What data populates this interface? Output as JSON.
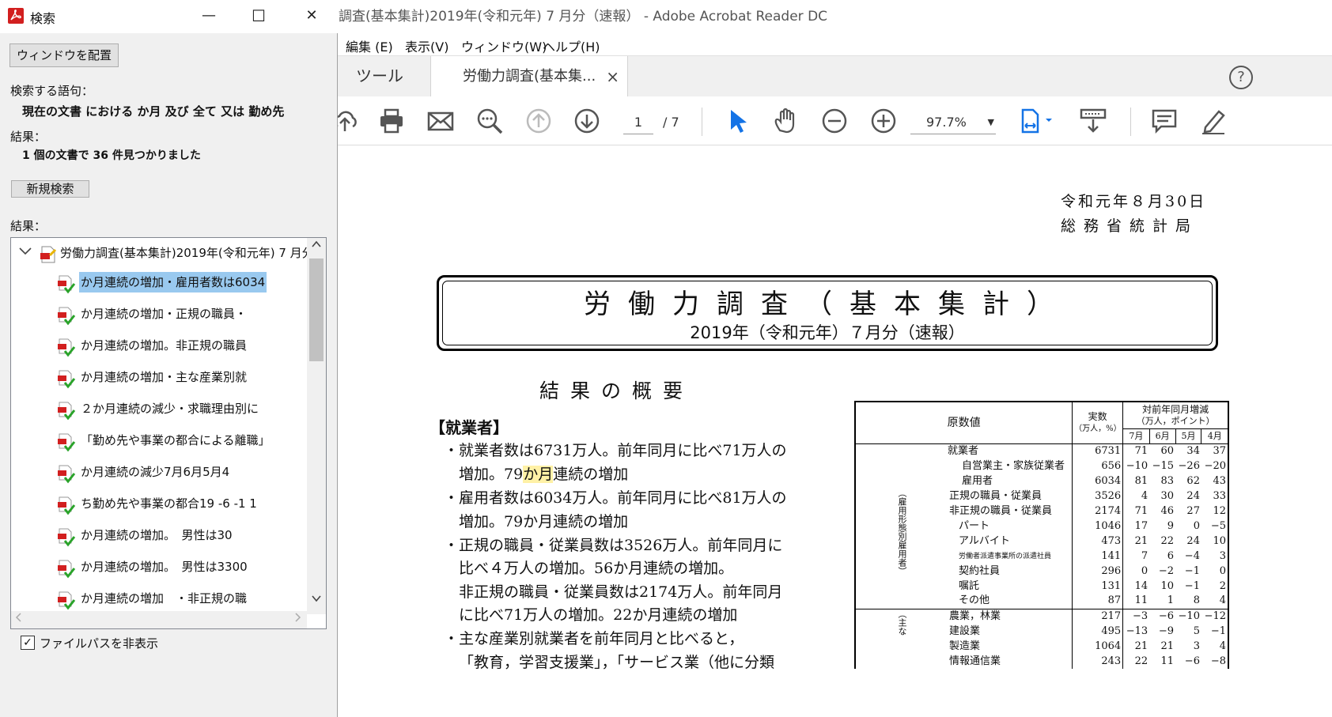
{
  "search_window": {
    "title": "検索",
    "minimize": "—",
    "maximize": "☐",
    "close": "✕",
    "arrange_button": "ウィンドウを配置",
    "term_label": "検索する語句：",
    "term_value": "現在の文書 における か月 及び 全て 又は 勤め先",
    "result_label": "結果：",
    "result_value": "1 個の文書で 36 件見つかりました",
    "new_search_button": "新規検索",
    "results_label": "結果：",
    "tree_root": "労働力調査(基本集計)2019年(令和元年) 7 月分",
    "results": [
      {
        "text": "か月連続の増加・雇用者数は6034",
        "selected": true
      },
      {
        "text": "か月連続の増加・正規の職員・",
        "selected": false
      },
      {
        "text": "か月連続の増加。非正規の職員",
        "selected": false
      },
      {
        "text": "か月連続の増加・主な産業別就",
        "selected": false
      },
      {
        "text": "２か月連続の減少・求職理由別に",
        "selected": false
      },
      {
        "text": "「勤め先や事業の都合による離職」",
        "selected": false
      },
      {
        "text": "か月連続の減少7月6月5月4",
        "selected": false
      },
      {
        "text": "ち勤め先や事業の都合19 -6 -1 1",
        "selected": false
      },
      {
        "text": "か月連続の増加。　男性は30",
        "selected": false
      },
      {
        "text": "か月連続の増加。　男性は3300",
        "selected": false
      },
      {
        "text": "か月連続の増加　・非正規の職",
        "selected": false
      }
    ],
    "hide_path_label": "ファイルパスを非表示",
    "hide_path_checked": "✓"
  },
  "acrobat": {
    "title": "調査(基本集計)2019年(令和元年) 7 月分（速報） - Adobe Acrobat Reader DC",
    "menu": [
      "編集 (E)",
      "表示(V)",
      "ウィンドウ(W)",
      "ヘルプ(H)"
    ],
    "tab_tools": "ツール",
    "tab_doc": "労働力調査(基本集...",
    "tab_close": "×",
    "help": "?",
    "page_current": "1",
    "page_total": "/ 7",
    "zoom": "97.7%",
    "zoom_caret": "▼"
  },
  "document": {
    "date": "令和元年８月30日",
    "bureau": "総務省統計局",
    "title": "労働力調査（基本集計）",
    "subtitle": "2019年（令和元年）７月分（速報）",
    "summary_heading": "結果の概要",
    "employed_heading": "【就業者】",
    "lines": {
      "l1": "・就業者数は6731万人。前年同月に比べ71万人の",
      "l2a": "増加。79",
      "l2hl": "か月",
      "l2b": "連続の増加",
      "l3": "・雇用者数は6034万人。前年同月に比べ81万人の",
      "l4": "増加。79か月連続の増加",
      "l5": "・正規の職員・従業員数は3526万人。前年同月に",
      "l6": "比べ４万人の増加。56か月連続の増加。",
      "l7": "非正規の職員・従業員数は2174万人。前年同月",
      "l8": "に比べ71万人の増加。22か月連続の増加",
      "l9": "・主な産業別就業者を前年同月と比べると，",
      "l10": "「教育，学習支援業」，「サービス業（他に分類"
    },
    "table": {
      "h_raw": "原数値",
      "h_actual": "実数",
      "h_actual_unit": "（万人，%）",
      "h_change": "対前年同月増減",
      "h_change_unit": "（万人，ポイント）",
      "months": [
        "7月",
        "6月",
        "5月",
        "4月"
      ],
      "side1": "（雇用形態別雇用者）",
      "side2": "（主な",
      "rows": [
        {
          "label": "就業者",
          "values": [
            "6731",
            "71",
            "60",
            "34",
            "37"
          ]
        },
        {
          "label": "自営業主・家族従業者",
          "values": [
            "656",
            "−10",
            "−15",
            "−26",
            "−20"
          ]
        },
        {
          "label": "雇用者",
          "values": [
            "6034",
            "81",
            "83",
            "62",
            "43"
          ]
        },
        {
          "label": "正規の職員・従業員",
          "values": [
            "3526",
            "4",
            "30",
            "24",
            "33"
          ]
        },
        {
          "label": "非正規の職員・従業員",
          "values": [
            "2174",
            "71",
            "46",
            "27",
            "12"
          ]
        },
        {
          "label": "パート",
          "values": [
            "1046",
            "17",
            "9",
            "0",
            "−5"
          ]
        },
        {
          "label": "アルバイト",
          "values": [
            "473",
            "21",
            "22",
            "24",
            "10"
          ]
        },
        {
          "label": "労働者派遣事業所の派遣社員",
          "values": [
            "141",
            "7",
            "6",
            "−4",
            "3"
          ]
        },
        {
          "label": "契約社員",
          "values": [
            "296",
            "0",
            "−2",
            "−1",
            "0"
          ]
        },
        {
          "label": "嘱託",
          "values": [
            "131",
            "14",
            "10",
            "−1",
            "2"
          ]
        },
        {
          "label": "その他",
          "values": [
            "87",
            "11",
            "1",
            "8",
            "4"
          ]
        },
        {
          "label": "農業，林業",
          "values": [
            "217",
            "−3",
            "−6",
            "−10",
            "−12"
          ]
        },
        {
          "label": "建設業",
          "values": [
            "495",
            "−13",
            "−9",
            "5",
            "−1"
          ]
        },
        {
          "label": "製造業",
          "values": [
            "1064",
            "21",
            "21",
            "3",
            "4"
          ]
        },
        {
          "label": "情報通信業",
          "values": [
            "243",
            "22",
            "11",
            "−6",
            "−8"
          ]
        }
      ]
    }
  },
  "colors": {
    "selection": "#99c9ef",
    "highlight": "#fff1a6",
    "accent": "#1473e6",
    "acrobat_red": "#d21f1f"
  }
}
